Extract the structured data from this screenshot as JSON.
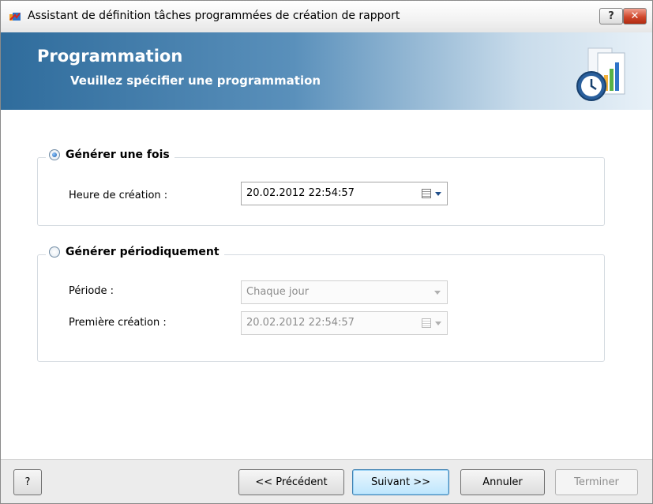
{
  "window": {
    "title": "Assistant de définition tâches programmées de création de rapport",
    "help_label": "?",
    "close_label": "✕"
  },
  "banner": {
    "title": "Programmation",
    "subtitle": "Veuillez spécifier une programmation"
  },
  "once": {
    "label": "Générer une fois",
    "selected": true,
    "time_label": "Heure de création :",
    "time_value": "20.02.2012 22:54:57"
  },
  "periodic": {
    "label": "Générer périodiquement",
    "selected": false,
    "period_label": "Période :",
    "period_value": "Chaque jour",
    "first_label": "Première création :",
    "first_value": "20.02.2012 22:54:57"
  },
  "footer": {
    "help": "?",
    "back": "<< Précédent",
    "next": "Suivant >>",
    "cancel": "Annuler",
    "finish": "Terminer"
  },
  "colors": {
    "banner_start": "#2f6c9c",
    "banner_end": "#e8f1f8",
    "default_button_border": "#3c7fb1"
  },
  "icons": [
    "app-icon",
    "help-icon",
    "close-icon",
    "clock-report-icon",
    "calendar-icon",
    "chevron-down-icon"
  ]
}
